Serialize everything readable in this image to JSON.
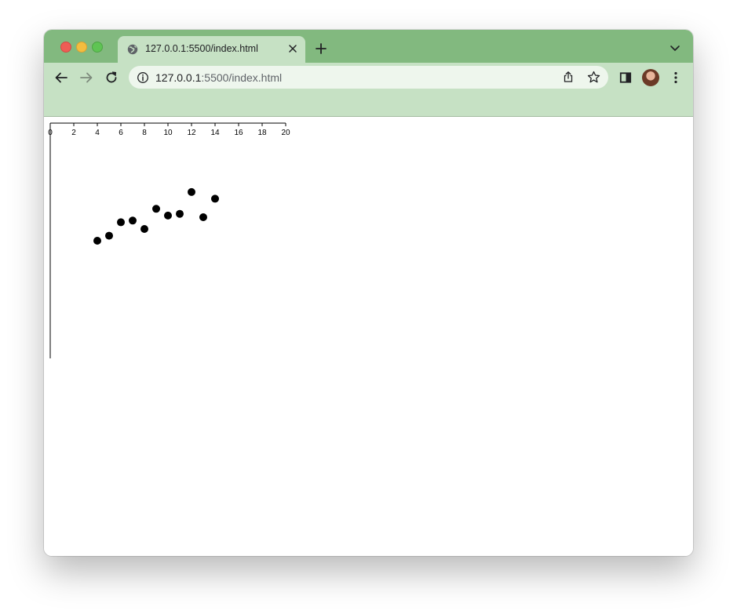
{
  "browser": {
    "tab_title": "127.0.0.1:5500/index.html",
    "url_host": "127.0.0.1",
    "url_rest": ":5500/index.html"
  },
  "icons": {
    "tab_favicon": "globe-icon",
    "tab_close": "close-icon",
    "new_tab": "plus-icon",
    "tab_search": "chevron-down-icon",
    "back": "arrow-left-icon",
    "forward": "arrow-right-icon",
    "reload": "reload-icon",
    "site_info": "info-icon",
    "share": "share-icon",
    "bookmark": "star-icon",
    "side_panel": "side-panel-icon",
    "profile": "avatar",
    "menu": "kebab-menu-icon"
  },
  "colors": {
    "tab_strip": "#82b97f",
    "toolbar": "#c6e1c4",
    "omnibox": "#eef6ed"
  },
  "chart_data": {
    "type": "scatter",
    "title": "",
    "xlabel": "",
    "ylabel": "",
    "xlim": [
      0,
      20
    ],
    "x_axis_position": "top",
    "x_ticks": [
      "0",
      "2",
      "4",
      "6",
      "8",
      "10",
      "12",
      "14",
      "16",
      "18",
      "20"
    ],
    "y_ticks": [],
    "grid": false,
    "points": [
      {
        "x": 4,
        "y": 0.7
      },
      {
        "x": 5,
        "y": 0.73
      },
      {
        "x": 6,
        "y": 0.81
      },
      {
        "x": 7,
        "y": 0.82
      },
      {
        "x": 8,
        "y": 0.77
      },
      {
        "x": 9,
        "y": 0.89
      },
      {
        "x": 10,
        "y": 0.85
      },
      {
        "x": 11,
        "y": 0.86
      },
      {
        "x": 12,
        "y": 0.99
      },
      {
        "x": 13,
        "y": 0.84
      },
      {
        "x": 14,
        "y": 0.95
      }
    ],
    "ylim": [
      0,
      1.4
    ]
  }
}
